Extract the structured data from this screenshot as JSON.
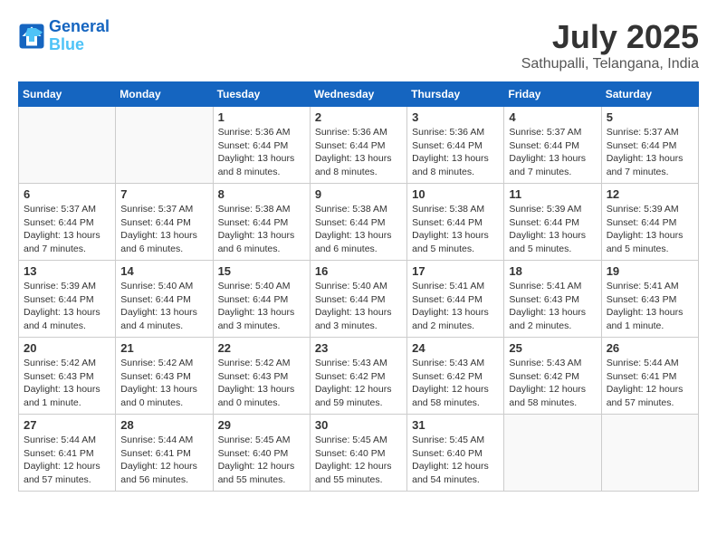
{
  "header": {
    "logo_line1": "General",
    "logo_line2": "Blue",
    "month": "July 2025",
    "location": "Sathupalli, Telangana, India"
  },
  "days_of_week": [
    "Sunday",
    "Monday",
    "Tuesday",
    "Wednesday",
    "Thursday",
    "Friday",
    "Saturday"
  ],
  "weeks": [
    [
      {
        "day": "",
        "info": ""
      },
      {
        "day": "",
        "info": ""
      },
      {
        "day": "1",
        "info": "Sunrise: 5:36 AM\nSunset: 6:44 PM\nDaylight: 13 hours and 8 minutes."
      },
      {
        "day": "2",
        "info": "Sunrise: 5:36 AM\nSunset: 6:44 PM\nDaylight: 13 hours and 8 minutes."
      },
      {
        "day": "3",
        "info": "Sunrise: 5:36 AM\nSunset: 6:44 PM\nDaylight: 13 hours and 8 minutes."
      },
      {
        "day": "4",
        "info": "Sunrise: 5:37 AM\nSunset: 6:44 PM\nDaylight: 13 hours and 7 minutes."
      },
      {
        "day": "5",
        "info": "Sunrise: 5:37 AM\nSunset: 6:44 PM\nDaylight: 13 hours and 7 minutes."
      }
    ],
    [
      {
        "day": "6",
        "info": "Sunrise: 5:37 AM\nSunset: 6:44 PM\nDaylight: 13 hours and 7 minutes."
      },
      {
        "day": "7",
        "info": "Sunrise: 5:37 AM\nSunset: 6:44 PM\nDaylight: 13 hours and 6 minutes."
      },
      {
        "day": "8",
        "info": "Sunrise: 5:38 AM\nSunset: 6:44 PM\nDaylight: 13 hours and 6 minutes."
      },
      {
        "day": "9",
        "info": "Sunrise: 5:38 AM\nSunset: 6:44 PM\nDaylight: 13 hours and 6 minutes."
      },
      {
        "day": "10",
        "info": "Sunrise: 5:38 AM\nSunset: 6:44 PM\nDaylight: 13 hours and 5 minutes."
      },
      {
        "day": "11",
        "info": "Sunrise: 5:39 AM\nSunset: 6:44 PM\nDaylight: 13 hours and 5 minutes."
      },
      {
        "day": "12",
        "info": "Sunrise: 5:39 AM\nSunset: 6:44 PM\nDaylight: 13 hours and 5 minutes."
      }
    ],
    [
      {
        "day": "13",
        "info": "Sunrise: 5:39 AM\nSunset: 6:44 PM\nDaylight: 13 hours and 4 minutes."
      },
      {
        "day": "14",
        "info": "Sunrise: 5:40 AM\nSunset: 6:44 PM\nDaylight: 13 hours and 4 minutes."
      },
      {
        "day": "15",
        "info": "Sunrise: 5:40 AM\nSunset: 6:44 PM\nDaylight: 13 hours and 3 minutes."
      },
      {
        "day": "16",
        "info": "Sunrise: 5:40 AM\nSunset: 6:44 PM\nDaylight: 13 hours and 3 minutes."
      },
      {
        "day": "17",
        "info": "Sunrise: 5:41 AM\nSunset: 6:44 PM\nDaylight: 13 hours and 2 minutes."
      },
      {
        "day": "18",
        "info": "Sunrise: 5:41 AM\nSunset: 6:43 PM\nDaylight: 13 hours and 2 minutes."
      },
      {
        "day": "19",
        "info": "Sunrise: 5:41 AM\nSunset: 6:43 PM\nDaylight: 13 hours and 1 minute."
      }
    ],
    [
      {
        "day": "20",
        "info": "Sunrise: 5:42 AM\nSunset: 6:43 PM\nDaylight: 13 hours and 1 minute."
      },
      {
        "day": "21",
        "info": "Sunrise: 5:42 AM\nSunset: 6:43 PM\nDaylight: 13 hours and 0 minutes."
      },
      {
        "day": "22",
        "info": "Sunrise: 5:42 AM\nSunset: 6:43 PM\nDaylight: 13 hours and 0 minutes."
      },
      {
        "day": "23",
        "info": "Sunrise: 5:43 AM\nSunset: 6:42 PM\nDaylight: 12 hours and 59 minutes."
      },
      {
        "day": "24",
        "info": "Sunrise: 5:43 AM\nSunset: 6:42 PM\nDaylight: 12 hours and 58 minutes."
      },
      {
        "day": "25",
        "info": "Sunrise: 5:43 AM\nSunset: 6:42 PM\nDaylight: 12 hours and 58 minutes."
      },
      {
        "day": "26",
        "info": "Sunrise: 5:44 AM\nSunset: 6:41 PM\nDaylight: 12 hours and 57 minutes."
      }
    ],
    [
      {
        "day": "27",
        "info": "Sunrise: 5:44 AM\nSunset: 6:41 PM\nDaylight: 12 hours and 57 minutes."
      },
      {
        "day": "28",
        "info": "Sunrise: 5:44 AM\nSunset: 6:41 PM\nDaylight: 12 hours and 56 minutes."
      },
      {
        "day": "29",
        "info": "Sunrise: 5:45 AM\nSunset: 6:40 PM\nDaylight: 12 hours and 55 minutes."
      },
      {
        "day": "30",
        "info": "Sunrise: 5:45 AM\nSunset: 6:40 PM\nDaylight: 12 hours and 55 minutes."
      },
      {
        "day": "31",
        "info": "Sunrise: 5:45 AM\nSunset: 6:40 PM\nDaylight: 12 hours and 54 minutes."
      },
      {
        "day": "",
        "info": ""
      },
      {
        "day": "",
        "info": ""
      }
    ]
  ]
}
